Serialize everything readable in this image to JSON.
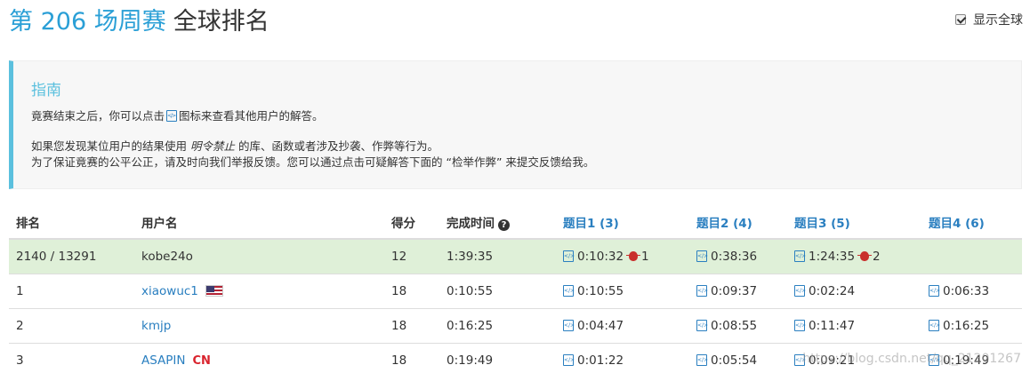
{
  "header": {
    "contest_title": "第 206 场周赛",
    "rank_title": "全球排名"
  },
  "toggle": {
    "label": "显示全球",
    "checked": true
  },
  "guide": {
    "title": "指南",
    "line1_before": "竟赛结束之后，你可以点击",
    "line1_after": "图标来查看其他用户的解答。",
    "line2_before": "如果您发现某位用户的结果使用 ",
    "line2_em": "明令禁止",
    "line2_after": " 的库、函数或者涉及抄袭、作弊等行为。",
    "line3": "为了保证竟赛的公平公正，请及时向我们举报反馈。您可以通过点击可疑解答下面的 “检举作弊” 来提交反馈给我。"
  },
  "table": {
    "headers": {
      "rank": "排名",
      "user": "用户名",
      "score": "得分",
      "finish": "完成时间",
      "q1": "题目1 (3)",
      "q2": "题目2 (4)",
      "q3": "题目3 (5)",
      "q4": "题目4 (6)"
    },
    "rows": [
      {
        "rank": "2140 / 13291",
        "user": "kobe24o",
        "score": "12",
        "finish": "1:39:35",
        "q1": "0:10:32",
        "q1_bugs": "1",
        "q2": "0:38:36",
        "q3": "1:24:35",
        "q3_bugs": "2",
        "q4": ""
      },
      {
        "rank": "1",
        "user": "xiaowuc1",
        "score": "18",
        "finish": "0:10:55",
        "q1": "0:10:55",
        "q2": "0:09:37",
        "q3": "0:02:24",
        "q4": "0:06:33"
      },
      {
        "rank": "2",
        "user": "kmjp",
        "score": "18",
        "finish": "0:16:25",
        "q1": "0:04:47",
        "q2": "0:08:55",
        "q3": "0:11:47",
        "q4": "0:16:25"
      },
      {
        "rank": "3",
        "user": "ASAPIN",
        "region": "CN",
        "score": "18",
        "finish": "0:19:49",
        "q1": "0:01:22",
        "q2": "0:05:54",
        "q3": "0:09:21",
        "q4": "0:19:49"
      }
    ]
  },
  "watermark": "https://blog.csdn.net/qq_21201267"
}
